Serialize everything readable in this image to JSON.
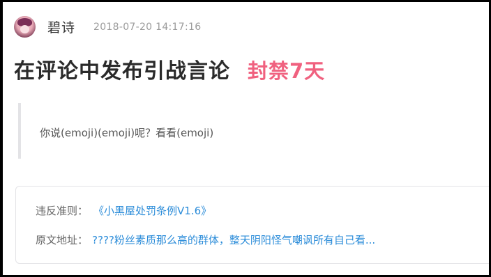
{
  "header": {
    "username": "碧诗",
    "timestamp": "2018-07-20 14:17:16"
  },
  "title": {
    "text": "在评论中发布引战言论",
    "penalty": "封禁7天"
  },
  "quote": {
    "text": "你说(emoji)(emoji)呢？看看(emoji)"
  },
  "card": {
    "rule_label": "违反准则：",
    "rule_link": "《小黑屋处罚条例V1.6》",
    "source_label": "原文地址：",
    "source_link": "????粉丝素质那么高的群体，整天阴阳怪气嘲讽所有自己看..."
  },
  "colors": {
    "penalty": "#f0617f",
    "link": "#2b8cd9",
    "timestamp": "#9b9b9b",
    "quote_bar": "#e3e3e6"
  },
  "icons": {
    "avatar": "user-avatar"
  }
}
